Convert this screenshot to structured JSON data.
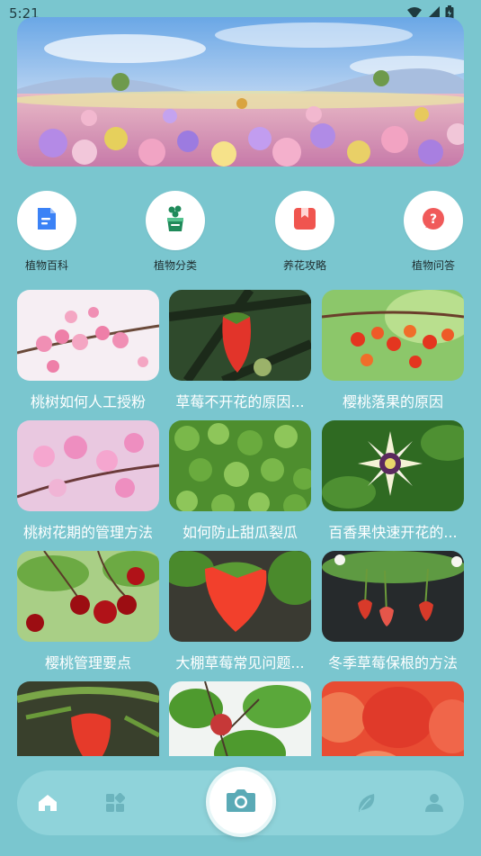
{
  "status_bar": {
    "time": "5:21",
    "icons": [
      "wifi-icon",
      "signal-icon",
      "battery-icon"
    ]
  },
  "banner": {
    "description_icon": "flower-field-banner"
  },
  "quick_actions": [
    {
      "label": "植物百科",
      "icon": "document-icon",
      "color": "#3b82f6"
    },
    {
      "label": "植物分类",
      "icon": "plant-pot-icon",
      "color": "#1f8a5a"
    },
    {
      "label": "养花攻略",
      "icon": "bookmark-book-icon",
      "color": "#f0554f"
    },
    {
      "label": "植物问答",
      "icon": "question-bubble-icon",
      "color": "#f05a5a"
    }
  ],
  "articles": [
    {
      "title": "桃树如何人工授粉"
    },
    {
      "title": "草莓不开花的原因..."
    },
    {
      "title": "樱桃落果的原因"
    },
    {
      "title": "桃树花期的管理方法"
    },
    {
      "title": "如何防止甜瓜裂瓜"
    },
    {
      "title": "百香果快速开花的..."
    },
    {
      "title": "樱桃管理要点"
    },
    {
      "title": "大棚草莓常见问题..."
    },
    {
      "title": "冬季草莓保根的方法"
    },
    {
      "title": ""
    },
    {
      "title": ""
    },
    {
      "title": ""
    }
  ],
  "bottom_nav": {
    "items": [
      "home-icon",
      "category-icon",
      "camera-icon",
      "leaf-icon",
      "profile-icon"
    ]
  },
  "colors": {
    "background": "#7ac6cf",
    "nav_bar": "#8fd3da",
    "accent": "#5aaab6"
  }
}
